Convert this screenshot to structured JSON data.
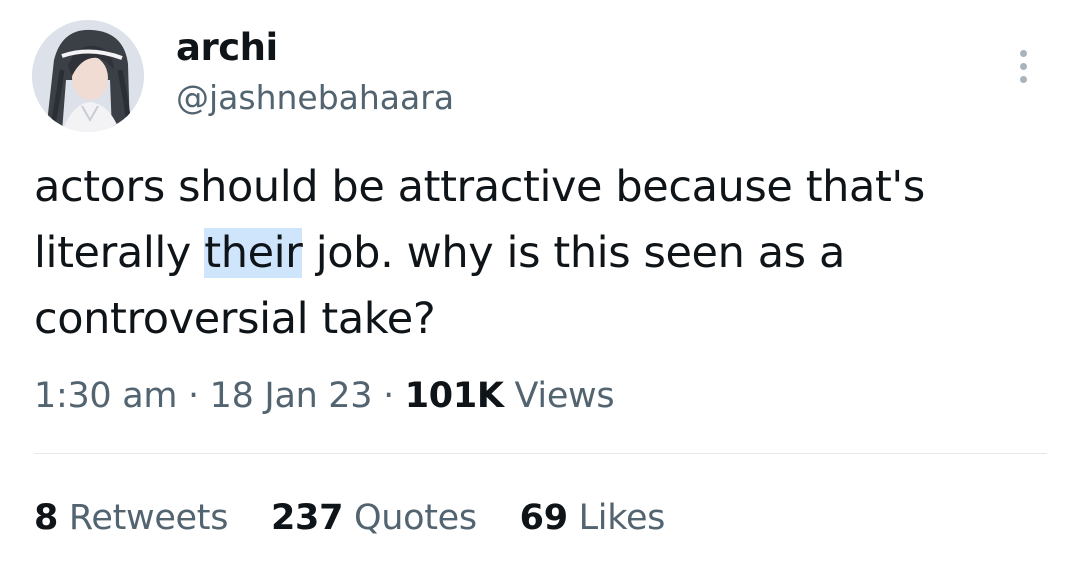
{
  "author": {
    "display_name": "archi",
    "handle": "@jashnebahaara",
    "avatar_icon": "profile-avatar"
  },
  "more_icon": "more-options-icon",
  "tweet": {
    "text_part1": "actors should be attractive because that's literally ",
    "highlighted_word": "their",
    "text_part2": " job. why is this seen as a controversial take?",
    "highlight_color": "#cfe5fb"
  },
  "meta": {
    "time": "1:30 am",
    "separator": "·",
    "date": "18 Jan 23",
    "views_count": "101K",
    "views_label": "Views"
  },
  "stats": [
    {
      "count": "8",
      "label": "Retweets"
    },
    {
      "count": "237",
      "label": "Quotes"
    },
    {
      "count": "69",
      "label": "Likes"
    }
  ],
  "colors": {
    "text_primary": "#0f1419",
    "text_secondary": "#536471",
    "divider": "#e6e9ec"
  }
}
